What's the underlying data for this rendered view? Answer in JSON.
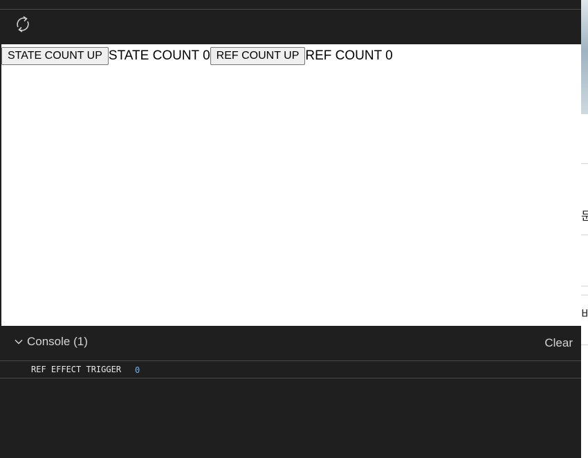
{
  "toolbar": {
    "refresh_icon": "refresh-icon"
  },
  "app": {
    "state_button_label": "STATE COUNT UP",
    "state_count_label": "STATE COUNT 0",
    "ref_button_label": "REF COUNT UP",
    "ref_count_label": "REF COUNT 0"
  },
  "console": {
    "title": "Console (1)",
    "clear_label": "Clear",
    "logs": [
      {
        "message": "REF EFFECT TRIGGER",
        "value": "0"
      }
    ]
  },
  "background_page": {
    "glyph_1": "문",
    "glyph_2": "비"
  },
  "colors": {
    "panel_bg": "#1f1f1f",
    "preview_bg": "#ffffff",
    "console_text": "#d4d4d4",
    "log_value": "#6fb3f2"
  }
}
